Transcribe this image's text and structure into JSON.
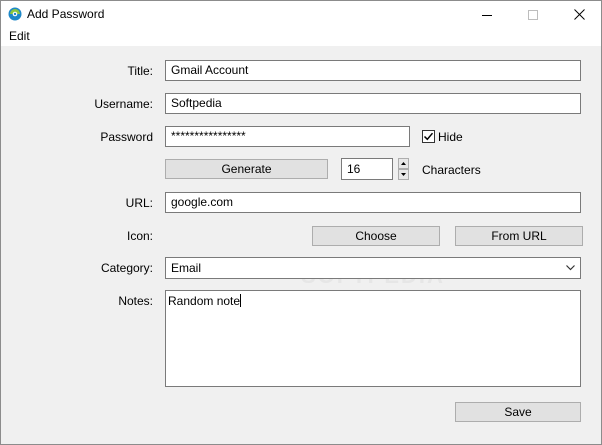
{
  "window": {
    "title": "Add Password"
  },
  "menu": {
    "items": [
      "Edit"
    ]
  },
  "form": {
    "title_label": "Title:",
    "title_value": "Gmail Account",
    "username_label": "Username:",
    "username_value": "Softpedia",
    "password_label": "Password",
    "password_value": "****************",
    "hide_label": "Hide",
    "hide_checked": true,
    "generate_label": "Generate",
    "length_value": "16",
    "characters_label": "Characters",
    "url_label": "URL:",
    "url_value": "google.com",
    "icon_label": "Icon:",
    "choose_label": "Choose",
    "from_url_label": "From URL",
    "category_label": "Category:",
    "category_value": "Email",
    "notes_label": "Notes:",
    "notes_value": "Random note",
    "save_label": "Save"
  },
  "watermark": "SOFTPEDIA"
}
